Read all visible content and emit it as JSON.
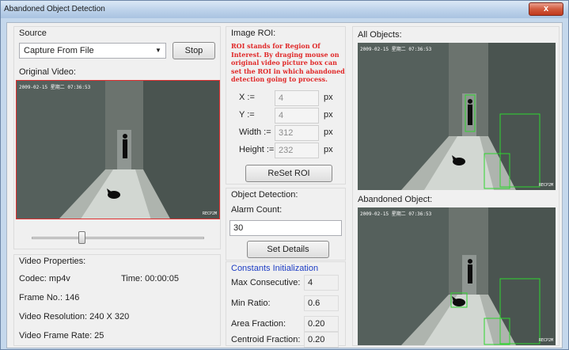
{
  "window": {
    "title": "Abandoned Object Detection",
    "close_glyph": "x"
  },
  "source": {
    "heading": "Source",
    "combo_value": "Capture From File",
    "stop_label": "Stop",
    "original_heading": "Original Video:",
    "timestamp": "2009-02-15 星期二 07:36:53",
    "watermark": "RECP2M",
    "slider_position": 0.28
  },
  "roi": {
    "heading": "Image ROI:",
    "note": "ROI stands for Region Of Interest. By draging mouse on original video picture box can set the ROI in which abandoned detection going to process.",
    "x_label": "X :=",
    "x_value": "4",
    "y_label": "Y :=",
    "y_value": "4",
    "w_label": "Width :=",
    "w_value": "312",
    "h_label": "Height :=",
    "h_value": "232",
    "unit": "px",
    "reset_label": "ReSet ROI"
  },
  "detection": {
    "heading": "Object Detection:",
    "alarm_label": "Alarm Count:",
    "alarm_value": "30",
    "set_label": "Set Details",
    "constants_heading": "Constants Initialization",
    "max_consec_label": "Max Consecutive:",
    "max_consec_value": "4",
    "min_ratio_label": "Min Ratio:",
    "min_ratio_value": "0.6",
    "area_frac_label": "Area Fraction:",
    "area_frac_value": "0.20",
    "centroid_label": "Centroid Fraction:",
    "centroid_value": "0.20"
  },
  "props": {
    "heading": "Video Properties:",
    "codec": "Codec: mp4v",
    "time": "Time: 00:00:05",
    "frame": "Frame No.: 146",
    "resolution": "Video Resolution: 240 X 320",
    "framerate": "Video Frame Rate: 25"
  },
  "results": {
    "all_heading": "All Objects:",
    "abandoned_heading": "Abandoned Object:",
    "timestamp": "2009-02-15 星期二 07:36:53",
    "watermark": "RECP2M"
  },
  "colors": {
    "red_text": "#e02828",
    "blue_text": "#1d3dc4",
    "detection_box": "#2fd62f",
    "selection_border": "#e03030"
  }
}
